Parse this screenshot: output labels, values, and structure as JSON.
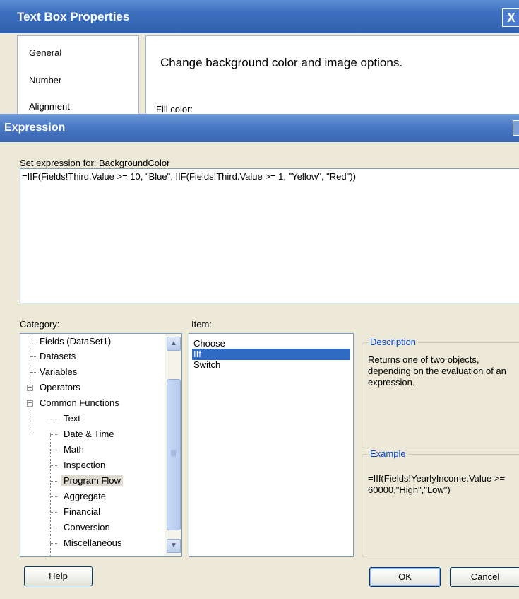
{
  "back_dialog": {
    "title": "Text Box Properties",
    "close_glyph": "X",
    "nav": [
      "General",
      "Number",
      "Alignment"
    ],
    "heading": "Change background color and image options.",
    "fill_color_label": "Fill color:"
  },
  "expression_dialog": {
    "title": "Expression",
    "set_expression_label": "Set expression for: BackgroundColor",
    "expression": "=IIF(Fields!Third.Value >= 10, \"Blue\", IIF(Fields!Third.Value >= 1, \"Yellow\", \"Red\"))",
    "category_label": "Category:",
    "item_label": "Item:",
    "categories": {
      "fields": "Fields (DataSet1)",
      "datasets": "Datasets",
      "variables": "Variables",
      "operators": "Operators",
      "common_functions": "Common Functions",
      "text": "Text",
      "date_time": "Date & Time",
      "math": "Math",
      "inspection": "Inspection",
      "program_flow": "Program Flow",
      "aggregate": "Aggregate",
      "financial": "Financial",
      "conversion": "Conversion",
      "miscellaneous": "Miscellaneous"
    },
    "selected_category": "Program Flow",
    "items": [
      "Choose",
      "IIf",
      "Switch"
    ],
    "selected_item": "IIf",
    "description_title": "Description",
    "description": "Returns one of two objects, depending on the evaluation of an expression.",
    "example_title": "Example",
    "example": "=IIf(Fields!YearlyIncome.Value >= 60000,\"High\",\"Low\")",
    "buttons": {
      "help": "Help",
      "ok": "OK",
      "cancel": "Cancel"
    },
    "icons": {
      "plus_glyph": "+",
      "minus_glyph": "−",
      "scroll_up": "▲",
      "scroll_down": "▼"
    }
  },
  "colors": {
    "title_bar": "#3b6fbe",
    "selection": "#316ac5",
    "group_title": "#0046d5",
    "dialog_face": "#ece9d8"
  }
}
